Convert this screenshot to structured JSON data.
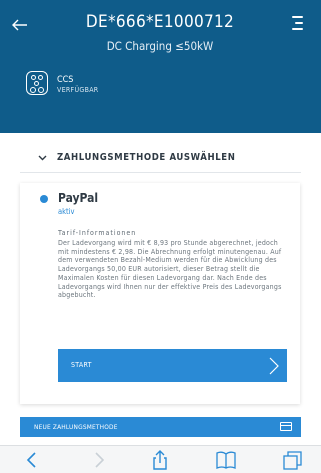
{
  "header": {
    "station_id": "DE*666*E1000712",
    "subtitle": "DC Charging ≤50kW",
    "connector": {
      "type": "CCS",
      "status": "VERFÜGBAR",
      "icon": "ccs-plug-icon"
    },
    "icons": {
      "back": "back-arrow-icon",
      "menu": "menu-icon"
    }
  },
  "payment_section": {
    "title": "ZAHLUNGSMETHODE AUSWÄHLEN",
    "method": {
      "name": "PayPal",
      "status": "aktiv",
      "tarif_title": "Tarif-Informationen",
      "tarif_text": "Der Ladevorgang wird mit € 8,93 pro Stunde abgerechnet, jedoch mit mindestens € 2,98. Die Abrechnung erfolgt minutengenau. Auf dem verwendeten Bezahl-Medium werden für die Abwicklung des Ladevorgangs 50,00 EUR autorisiert, dieser Betrag stellt die Maximalen Kosten für diesen Ladevorgang dar. Nach Ende des Ladevorgangs wird Ihnen nur der effektive Preis des Ladevorgangs abgebucht.",
      "start_label": "START"
    },
    "new_method_label": "NEUE ZAHLUNGSMETHODE"
  },
  "colors": {
    "header_bg": "#0f5c8a",
    "accent": "#2a8ad5"
  },
  "browser_toolbar": {
    "icons": [
      "back-icon",
      "forward-icon",
      "share-icon",
      "bookmarks-icon",
      "tabs-icon"
    ]
  }
}
